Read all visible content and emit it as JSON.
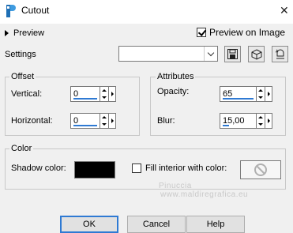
{
  "window": {
    "title": "Cutout"
  },
  "preview": {
    "toggle_label": "Preview",
    "preview_on_image_label": "Preview on Image",
    "preview_on_image_checked": true
  },
  "settings": {
    "label": "Settings",
    "value": ""
  },
  "offset": {
    "group_label": "Offset",
    "vertical_label": "Vertical:",
    "vertical_value": "0",
    "horizontal_label": "Horizontal:",
    "horizontal_value": "0"
  },
  "attributes": {
    "group_label": "Attributes",
    "opacity_label": "Opacity:",
    "opacity_value": "65",
    "blur_label": "Blur:",
    "blur_value": "15,00"
  },
  "color": {
    "group_label": "Color",
    "shadow_color_label": "Shadow color:",
    "shadow_color": "#000000",
    "fill_interior_label": "Fill interior with color:",
    "fill_interior_checked": false
  },
  "watermark": {
    "name": "Pinuccia",
    "site": "www.maldiregrafica.eu"
  },
  "buttons": {
    "ok": "OK",
    "cancel": "Cancel",
    "help": "Help"
  },
  "colors": {
    "accent": "#2f7ad3",
    "background": "#f0f0f0"
  }
}
